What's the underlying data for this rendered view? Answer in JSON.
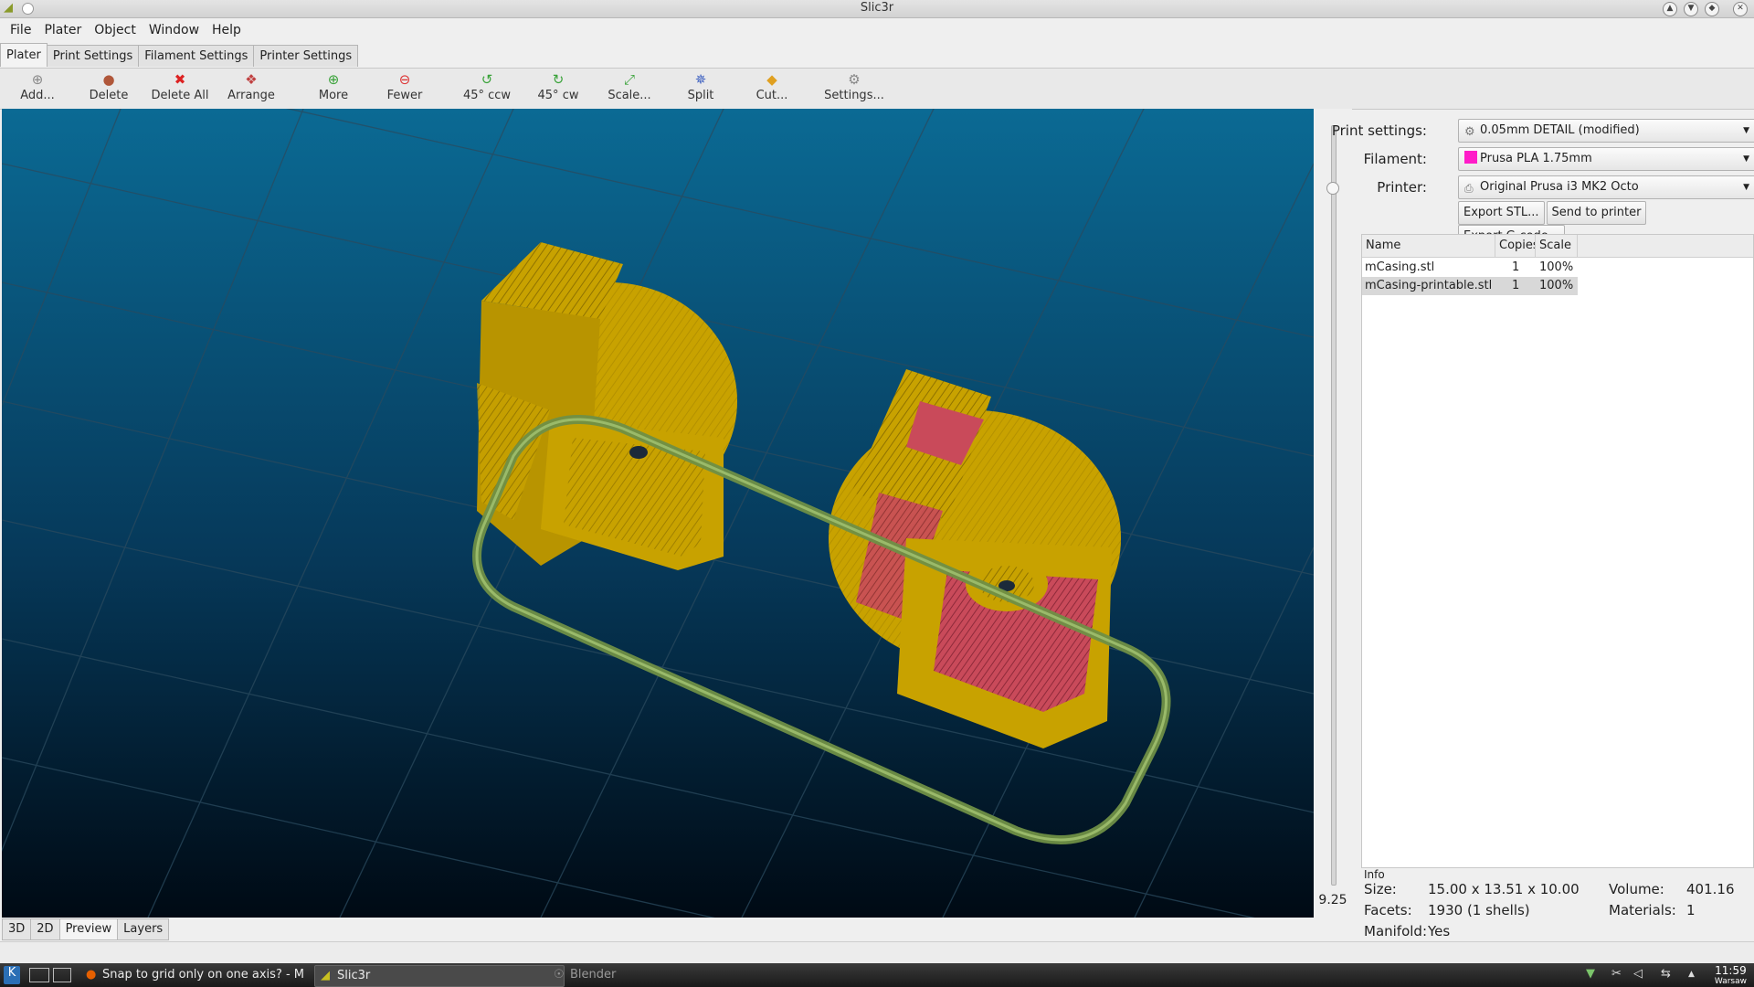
{
  "window": {
    "title": "Slic3r"
  },
  "menu": [
    "File",
    "Plater",
    "Object",
    "Window",
    "Help"
  ],
  "tabs": [
    "Plater",
    "Print Settings",
    "Filament Settings",
    "Printer Settings"
  ],
  "toolbar": {
    "add": "Add...",
    "delete": "Delete",
    "delete_all": "Delete All",
    "arrange": "Arrange",
    "more": "More",
    "fewer": "Fewer",
    "rot_ccw": "45° ccw",
    "rot_cw": "45° cw",
    "scale": "Scale...",
    "split": "Split",
    "cut": "Cut...",
    "settings": "Settings..."
  },
  "viewport": {
    "layer_value": "9.25",
    "colors": {
      "bg_top": "#0b6a94",
      "bg_bottom": "#000a14",
      "model": "#c8a200",
      "infill": "#c94a5a",
      "skirt": "#6f8f46"
    }
  },
  "view_tabs": [
    "3D",
    "2D",
    "Preview",
    "Layers"
  ],
  "panel": {
    "print_label": "Print settings:",
    "print_value": "0.05mm DETAIL (modified)",
    "filament_label": "Filament:",
    "filament_value": "Prusa PLA 1.75mm",
    "filament_color": "#ff1cc8",
    "printer_label": "Printer:",
    "printer_value": "Original Prusa i3 MK2 Octo",
    "export_stl": "Export STL...",
    "send_to_printer": "Send to printer",
    "export_gcode": "Export G-code..."
  },
  "object_list": {
    "columns": [
      "Name",
      "Copies",
      "Scale"
    ],
    "rows": [
      {
        "name": "mCasing.stl",
        "copies": "1",
        "scale": "100%"
      },
      {
        "name": "mCasing-printable.stl",
        "copies": "1",
        "scale": "100%"
      }
    ]
  },
  "info": {
    "title": "Info",
    "size_label": "Size:",
    "size_value": "15.00 x 13.51 x 10.00",
    "volume_label": "Volume:",
    "volume_value": "401.16",
    "facets_label": "Facets:",
    "facets_value": "1930 (1 shells)",
    "materials_label": "Materials:",
    "materials_value": "1",
    "manifold_label": "Manifold:",
    "manifold_value": "Yes"
  },
  "taskbar": {
    "firefox_task": "Snap to grid only on one axis? - M",
    "slic3r_task": "Slic3r",
    "blender_task": "Blender",
    "clock_time": "11:59",
    "clock_zone": "Warsaw"
  }
}
